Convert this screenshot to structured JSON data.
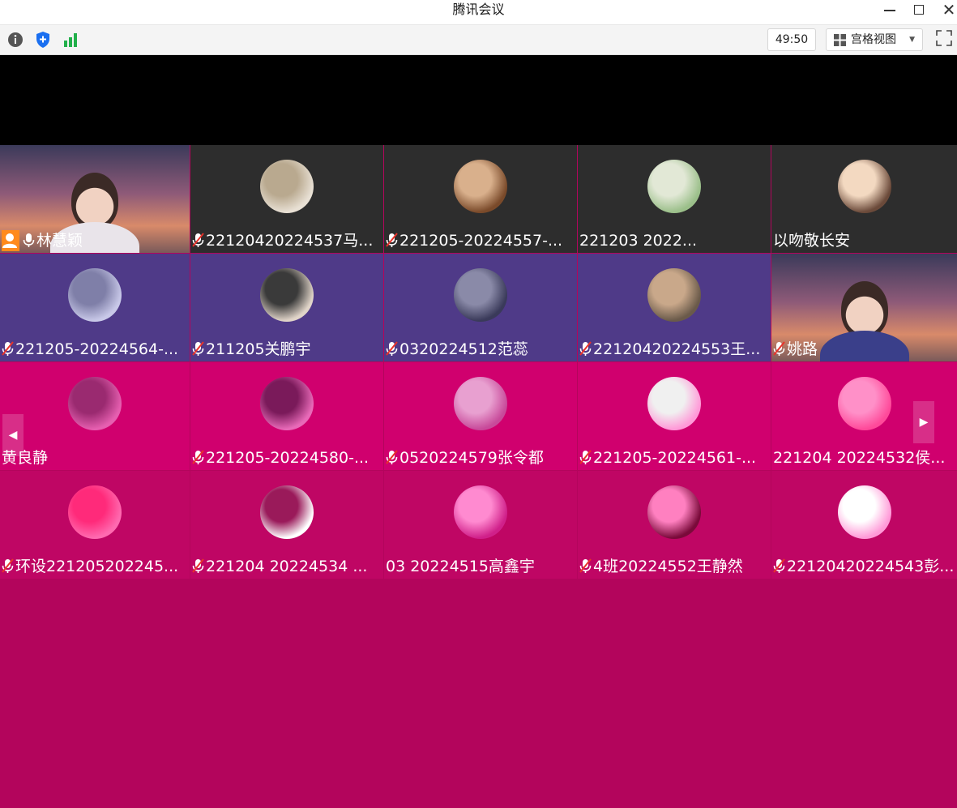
{
  "window": {
    "title": "腾讯会议",
    "close_glyph": "✕"
  },
  "toolbar": {
    "info_icon": "info-icon",
    "security_icon": "shield-icon",
    "network_icon": "signal-icon",
    "timer": "49:50",
    "view_mode_label": "宫格视图",
    "view_mode_caret": "▼",
    "fullscreen_icon": "fullscreen-icon"
  },
  "grid": {
    "scroll_left_glyph": "◀",
    "scroll_right_glyph": "▶",
    "rows": [
      {
        "participants": [
          {
            "name": "林慧颖",
            "video_on": true,
            "host": true,
            "mic": "on"
          },
          {
            "name": "22120420224537马...",
            "mic": "muted"
          },
          {
            "name": "221205-20224557-...",
            "mic": "muted"
          },
          {
            "name": "221203 2022...",
            "mic": "none"
          },
          {
            "name": "以吻敬长安",
            "mic": "none"
          }
        ]
      },
      {
        "participants": [
          {
            "name": "221205-20224564-...",
            "mic": "muted"
          },
          {
            "name": "211205关鹏宇",
            "mic": "muted"
          },
          {
            "name": "0320224512范蕊",
            "mic": "muted"
          },
          {
            "name": "22120420224553王...",
            "mic": "muted"
          },
          {
            "name": "姚路",
            "video_on": true,
            "mic": "muted"
          }
        ]
      },
      {
        "participants": [
          {
            "name": "黄良静",
            "mic": "none"
          },
          {
            "name": "221205-20224580-...",
            "mic": "muted"
          },
          {
            "name": "0520224579张令都",
            "mic": "muted"
          },
          {
            "name": "221205-20224561-...",
            "mic": "muted"
          },
          {
            "name": "221204 20224532侯...",
            "mic": "none"
          }
        ]
      },
      {
        "participants": [
          {
            "name": "环设221205202245...",
            "mic": "muted"
          },
          {
            "name": "221204 20224534 ...",
            "mic": "muted"
          },
          {
            "name": "03 20224515高鑫宇",
            "mic": "none"
          },
          {
            "name": "4班20224552王静然",
            "mic": "muted"
          },
          {
            "name": "22120420224543彭...",
            "mic": "muted"
          }
        ]
      }
    ]
  },
  "colors": {
    "row1_tile": "#2d2d2d",
    "row2_tile": "#4f3a88",
    "row3_tile": "#d0006e",
    "row4_tile": "#bf0664",
    "background": "#b3055c",
    "host_badge": "#ff8a1c"
  }
}
